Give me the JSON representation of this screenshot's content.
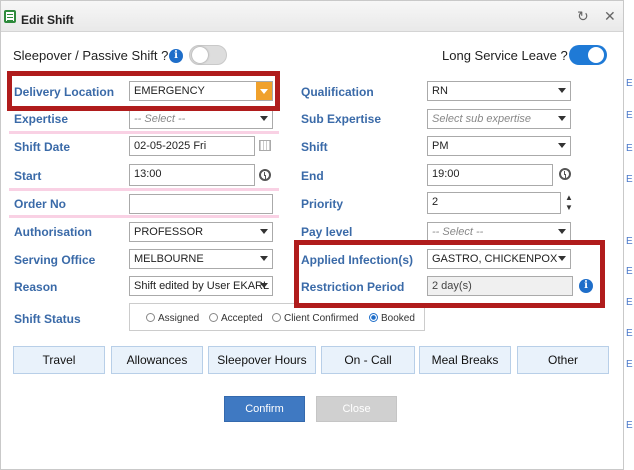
{
  "dialog": {
    "title": "Edit Shift"
  },
  "top": {
    "sleepover_label": "Sleepover / Passive Shift ?",
    "long_service_label": "Long Service Leave ?"
  },
  "left": {
    "delivery_location_label": "Delivery Location",
    "delivery_location_value": "EMERGENCY",
    "expertise_label": "Expertise",
    "expertise_placeholder": "-- Select --",
    "shift_date_label": "Shift Date",
    "shift_date_value": "02-05-2025 Fri",
    "start_label": "Start",
    "start_value": "13:00",
    "order_no_label": "Order No",
    "order_no_value": "",
    "authorisation_label": "Authorisation",
    "authorisation_value": "PROFESSOR",
    "serving_office_label": "Serving Office",
    "serving_office_value": "MELBOURNE",
    "reason_label": "Reason",
    "reason_value": "Shift edited by User EKARL",
    "shift_status_label": "Shift Status"
  },
  "right": {
    "qualification_label": "Qualification",
    "qualification_value": "RN",
    "sub_expertise_label": "Sub Expertise",
    "sub_expertise_placeholder": "Select sub expertise",
    "shift_label": "Shift",
    "shift_value": "PM",
    "end_label": "End",
    "end_value": "19:00",
    "priority_label": "Priority",
    "priority_value": "2",
    "pay_level_label": "Pay level",
    "pay_level_placeholder": "-- Select --",
    "applied_infections_label": "Applied Infection(s)",
    "applied_infections_value": "GASTRO, CHICKENPOX",
    "restriction_period_label": "Restriction Period",
    "restriction_period_value": "2 day(s)"
  },
  "shift_status": {
    "options": [
      "Assigned",
      "Accepted",
      "Client Confirmed",
      "Booked"
    ],
    "selected": "Booked"
  },
  "tabs": [
    "Travel",
    "Allowances",
    "Sleepover Hours",
    "On - Call",
    "Meal Breaks",
    "Other"
  ],
  "footer": {
    "confirm": "Confirm",
    "close": "Close"
  },
  "edge_letters": [
    "E",
    "E",
    "E",
    "E",
    "E",
    "E",
    "E",
    "E",
    "E",
    "E"
  ],
  "colors": {
    "accent": "#1f7ad6",
    "highlight": "#b01c1c",
    "label": "#3a6aa8",
    "dropdown_button": "#f0a12c"
  },
  "icons": [
    "edit-shift-icon",
    "restore-icon",
    "close-icon",
    "info-icon",
    "calendar-icon",
    "clock-icon"
  ]
}
